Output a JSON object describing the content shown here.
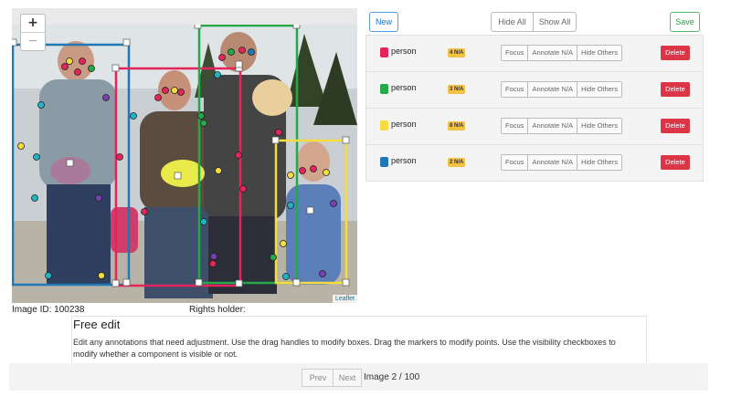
{
  "map": {
    "zoom_in": "+",
    "zoom_out": "−",
    "attribution": "Leaflet"
  },
  "image_meta": {
    "id_label": "Image ID: 100238",
    "rights_label": "Rights holder:"
  },
  "instructions": {
    "title": "Free edit",
    "body": "Edit any annotations that need adjustment. Use the drag handles to modify boxes. Drag the markers to modify points. Use the visibility checkboxes to modify whether a component is visible or not."
  },
  "pager": {
    "prev": "Prev",
    "next": "Next",
    "status": "Image 2 / 100"
  },
  "toolbar": {
    "new": "New",
    "hide_all": "Hide All",
    "show_all": "Show All",
    "save": "Save"
  },
  "annotations": [
    {
      "label": "person",
      "badge": "4 N/A",
      "color": "#e5245a"
    },
    {
      "label": "person",
      "badge": "3 N/A",
      "color": "#23a84a"
    },
    {
      "label": "person",
      "badge": "8 N/A",
      "color": "#f6dd3f"
    },
    {
      "label": "person",
      "badge": "2 N/A",
      "color": "#1f78b4"
    }
  ],
  "row_buttons": {
    "focus": "Focus",
    "annotate": "Annotate N/A",
    "hide_others": "Hide Others",
    "delete": "Delete"
  },
  "colors": {
    "box_blue": "#1f78b4",
    "box_red": "#e5245a",
    "box_green": "#23a84a",
    "box_yellow": "#f6dd3f",
    "delete_red": "#dc3545",
    "badge_yellow": "#f5c242"
  }
}
